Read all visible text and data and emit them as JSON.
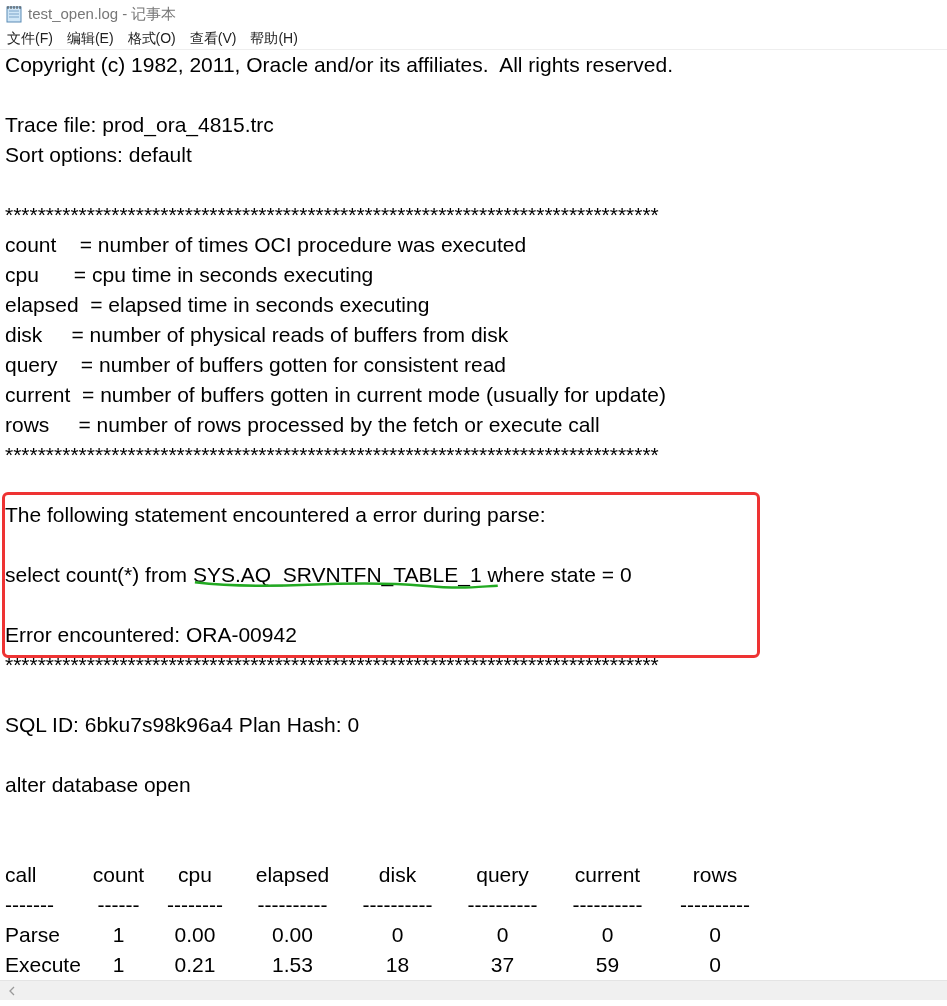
{
  "window": {
    "title": "test_open.log - 记事本"
  },
  "menu": [
    "文件(F)",
    "编辑(E)",
    "格式(O)",
    "查看(V)",
    "帮助(H)"
  ],
  "content": [
    {
      "kind": "line",
      "text": "Copyright (c) 1982, 2011, Oracle and/or its affiliates.  All rights reserved."
    },
    {
      "kind": "blank"
    },
    {
      "kind": "line",
      "text": "Trace file: prod_ora_4815.trc"
    },
    {
      "kind": "line",
      "text": "Sort options: default"
    },
    {
      "kind": "blank"
    },
    {
      "kind": "line",
      "text": "********************************************************************************"
    },
    {
      "kind": "line",
      "text": "count    = number of times OCI procedure was executed"
    },
    {
      "kind": "line",
      "text": "cpu      = cpu time in seconds executing"
    },
    {
      "kind": "line",
      "text": "elapsed  = elapsed time in seconds executing"
    },
    {
      "kind": "line",
      "text": "disk     = number of physical reads of buffers from disk"
    },
    {
      "kind": "line",
      "text": "query    = number of buffers gotten for consistent read"
    },
    {
      "kind": "line",
      "text": "current  = number of buffers gotten in current mode (usually for update)"
    },
    {
      "kind": "line",
      "text": "rows     = number of rows processed by the fetch or execute call"
    },
    {
      "kind": "line",
      "text": "********************************************************************************"
    },
    {
      "kind": "blank"
    },
    {
      "kind": "highlight",
      "lines": [
        {
          "kind": "line",
          "text": "The following statement encountered a error during parse:"
        },
        {
          "kind": "blank"
        },
        {
          "kind": "marked",
          "before": "select count(*) from ",
          "marked": "SYS.AQ_SRVNTFN_TABLE_1",
          "after": " where state = 0"
        },
        {
          "kind": "blank"
        },
        {
          "kind": "line",
          "text": "Error encountered: ORA-00942"
        }
      ]
    },
    {
      "kind": "line",
      "text": "********************************************************************************"
    },
    {
      "kind": "blank"
    },
    {
      "kind": "line",
      "text": "SQL ID: 6bku7s98k96a4 Plan Hash: 0"
    },
    {
      "kind": "blank"
    },
    {
      "kind": "line",
      "text": "alter database open"
    },
    {
      "kind": "blank"
    },
    {
      "kind": "blank"
    }
  ],
  "table": {
    "columns": [
      "call",
      "count",
      "cpu",
      "elapsed",
      "disk",
      "query",
      "current",
      "rows"
    ],
    "separators": [
      "-------",
      "------",
      "--------",
      "----------",
      "----------",
      "----------",
      "----------",
      "----------"
    ],
    "rows": [
      [
        "Parse",
        "1",
        "0.00",
        "0.00",
        "0",
        "0",
        "0",
        "0"
      ],
      [
        "Execute",
        "1",
        "0.21",
        "1.53",
        "18",
        "37",
        "59",
        "0"
      ]
    ]
  }
}
